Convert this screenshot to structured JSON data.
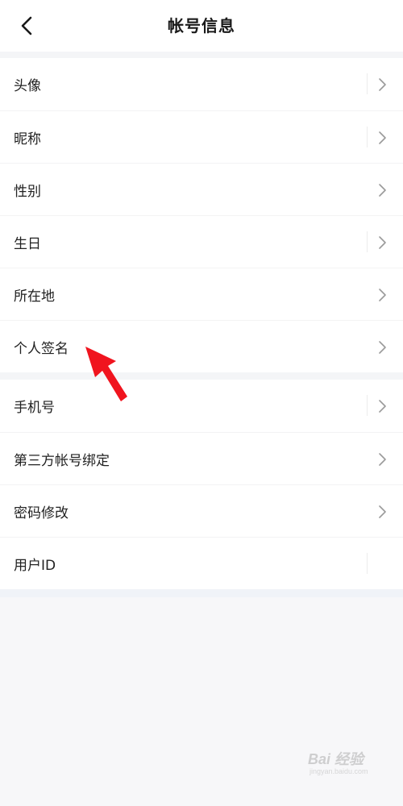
{
  "header": {
    "title": "帐号信息",
    "back_icon": "chevron-left-icon"
  },
  "group1": {
    "items": [
      {
        "label": "头像"
      },
      {
        "label": "昵称"
      },
      {
        "label": "性别"
      },
      {
        "label": "生日"
      },
      {
        "label": "所在地"
      },
      {
        "label": "个人签名"
      }
    ]
  },
  "group2": {
    "items": [
      {
        "label": "手机号"
      },
      {
        "label": "第三方帐号绑定"
      },
      {
        "label": "密码修改"
      },
      {
        "label": "用户ID"
      }
    ]
  },
  "annotation": {
    "arrow_color": "#f0141e",
    "icon": "red-arrow-icon"
  },
  "watermark": {
    "brand": "Bai 经验",
    "sub": "jingyan.baidu.com"
  }
}
